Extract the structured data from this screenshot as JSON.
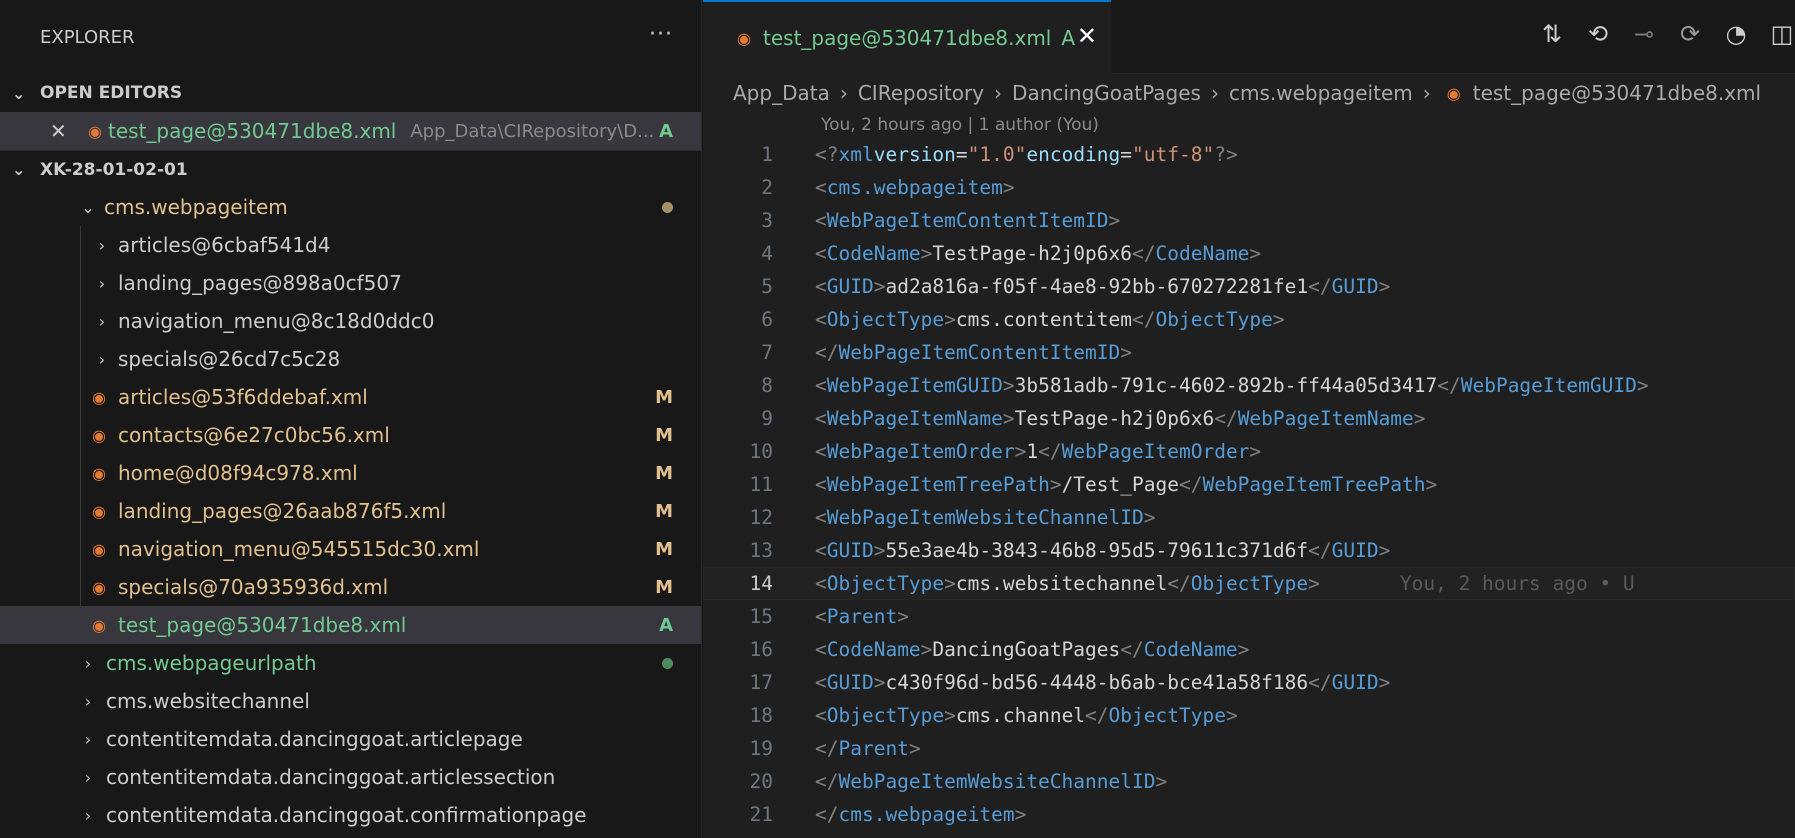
{
  "explorer": {
    "title": "EXPLORER",
    "more": "···",
    "open_editors_title": "OPEN EDITORS",
    "open_editor": {
      "name": "test_page@530471dbe8.xml",
      "path": "App_Data\\CIRepository\\D...",
      "status": "A"
    },
    "workspace_title": "XK-28-01-02-01",
    "tree": [
      {
        "label": "cms.webpageitem",
        "expanded": true,
        "color": "#e2c08d"
      },
      {
        "label": "articles@6cbaf541d4"
      },
      {
        "label": "landing_pages@898a0cf507"
      },
      {
        "label": "navigation_menu@8c18d0ddc0"
      },
      {
        "label": "specials@26cd7c5c28"
      },
      {
        "label": "articles@53f6ddebaf.xml",
        "status": "M"
      },
      {
        "label": "contacts@6e27c0bc56.xml",
        "status": "M"
      },
      {
        "label": "home@d08f94c978.xml",
        "status": "M"
      },
      {
        "label": "landing_pages@26aab876f5.xml",
        "status": "M"
      },
      {
        "label": "navigation_menu@545515dc30.xml",
        "status": "M"
      },
      {
        "label": "specials@70a935936d.xml",
        "status": "M"
      },
      {
        "label": "test_page@530471dbe8.xml",
        "status": "A"
      },
      {
        "label": "cms.webpageurlpath"
      },
      {
        "label": "cms.websitechannel"
      },
      {
        "label": "contentitemdata.dancinggoat.articlepage"
      },
      {
        "label": "contentitemdata.dancinggoat.articlessection"
      },
      {
        "label": "contentitemdata.dancinggoat.confirmationpage"
      }
    ]
  },
  "editor": {
    "tab": {
      "name": "test_page@530471dbe8.xml",
      "status": "A"
    },
    "breadcrumb": [
      "App_Data",
      "CIRepository",
      "DancingGoatPages",
      "cms.webpageitem",
      "test_page@530471dbe8.xml"
    ],
    "blame_header": "You, 2 hours ago | 1 author (You)",
    "inline_blame": "You, 2 hours ago • U",
    "line_numbers": [
      "1",
      "2",
      "3",
      "4",
      "5",
      "6",
      "7",
      "8",
      "9",
      "10",
      "11",
      "12",
      "13",
      "14",
      "15",
      "16",
      "17",
      "18",
      "19",
      "20",
      "21"
    ],
    "current_line": "14",
    "lines": {
      "l1": {
        "a1": "version",
        "v1": "\"1.0\"",
        "a2": "encoding",
        "v2": "\"utf-8\""
      },
      "l2": {
        "tag": "cms.webpageitem"
      },
      "l3": {
        "tag": "WebPageItemContentItemID"
      },
      "l4": {
        "tag": "CodeName",
        "text": "TestPage-h2j0p6x6"
      },
      "l5": {
        "tag": "GUID",
        "text": "ad2a816a-f05f-4ae8-92bb-670272281fe1"
      },
      "l6": {
        "tag": "ObjectType",
        "text": "cms.contentitem"
      },
      "l7": {
        "tag": "WebPageItemContentItemID"
      },
      "l8": {
        "tag": "WebPageItemGUID",
        "text": "3b581adb-791c-4602-892b-ff44a05d3417"
      },
      "l9": {
        "tag": "WebPageItemName",
        "text": "TestPage-h2j0p6x6"
      },
      "l10": {
        "tag": "WebPageItemOrder",
        "text": "1"
      },
      "l11": {
        "tag": "WebPageItemTreePath",
        "text": "/Test_Page"
      },
      "l12": {
        "tag": "WebPageItemWebsiteChannelID"
      },
      "l13": {
        "tag": "GUID",
        "text": "55e3ae4b-3843-46b8-95d5-79611c371d6f"
      },
      "l14": {
        "tag": "ObjectType",
        "text": "cms.websitechannel"
      },
      "l15": {
        "tag": "Parent"
      },
      "l16": {
        "tag": "CodeName",
        "text": "DancingGoatPages"
      },
      "l17": {
        "tag": "GUID",
        "text": "c430f96d-bd56-4448-b6ab-bce41a58f186"
      },
      "l18": {
        "tag": "ObjectType",
        "text": "cms.channel"
      },
      "l19": {
        "tag": "Parent"
      },
      "l20": {
        "tag": "WebPageItemWebsiteChannelID"
      },
      "l21": {
        "tag": "cms.webpageitem"
      }
    }
  }
}
